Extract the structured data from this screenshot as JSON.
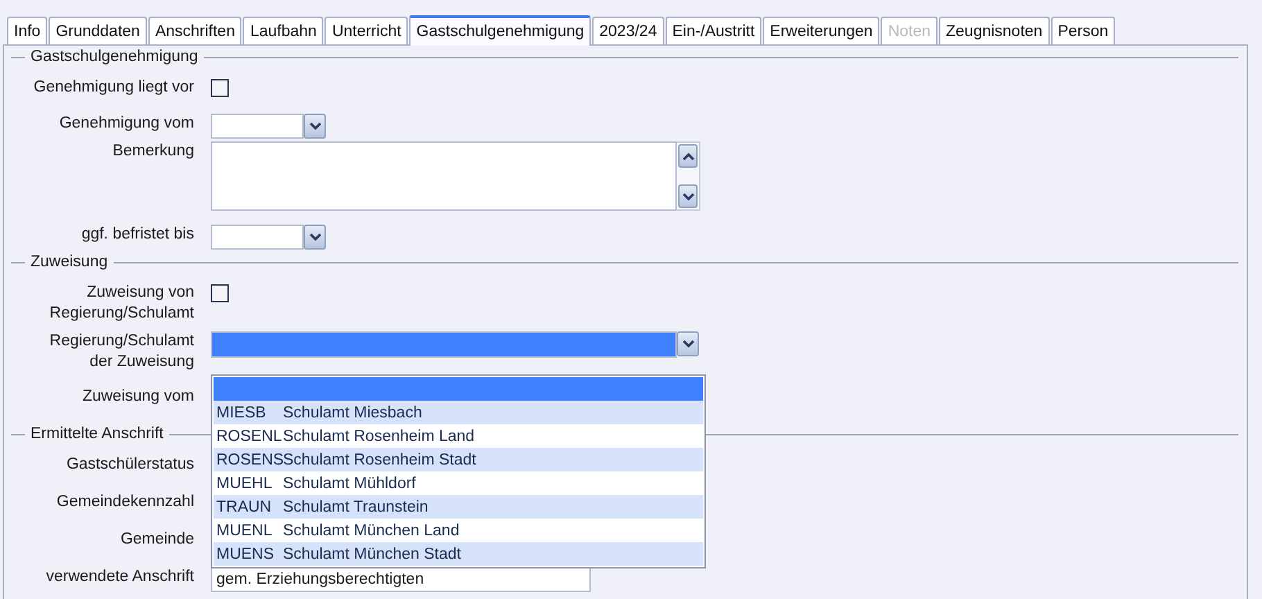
{
  "tabs": [
    {
      "label": "Info",
      "selected": false,
      "disabled": false
    },
    {
      "label": "Grunddaten",
      "selected": false,
      "disabled": false
    },
    {
      "label": "Anschriften",
      "selected": false,
      "disabled": false
    },
    {
      "label": "Laufbahn",
      "selected": false,
      "disabled": false
    },
    {
      "label": "Unterricht",
      "selected": false,
      "disabled": false
    },
    {
      "label": "Gastschulgenehmigung",
      "selected": true,
      "disabled": false
    },
    {
      "label": "2023/24",
      "selected": false,
      "disabled": false
    },
    {
      "label": "Ein-/Austritt",
      "selected": false,
      "disabled": false
    },
    {
      "label": "Erweiterungen",
      "selected": false,
      "disabled": false
    },
    {
      "label": "Noten",
      "selected": false,
      "disabled": true
    },
    {
      "label": "Zeugnisnoten",
      "selected": false,
      "disabled": false
    },
    {
      "label": "Person",
      "selected": false,
      "disabled": false
    }
  ],
  "sections": [
    {
      "title": "Gastschulgenehmigung",
      "rows": [
        {
          "kind": "checkbox",
          "label": "Genehmigung liegt vor",
          "checked": false
        },
        {
          "kind": "date",
          "label": "Genehmigung vom"
        },
        {
          "kind": "memo",
          "label": "Bemerkung"
        },
        {
          "kind": "date",
          "label": "ggf. befristet bis"
        }
      ]
    },
    {
      "title": "Zuweisung",
      "rows": [
        {
          "kind": "checkbox",
          "label": "Zuweisung von\nRegierung/Schulamt",
          "checked": false
        },
        {
          "kind": "combo",
          "label": "Regierung/Schulamt\nder Zuweisung",
          "open": true,
          "options": [
            {
              "code": "MIESB",
              "name": "Schulamt Miesbach",
              "selected": false
            },
            {
              "code": "ROSENL",
              "name": "Schulamt Rosenheim Land",
              "selected": false
            },
            {
              "code": "ROSENS",
              "name": "Schulamt Rosenheim Stadt",
              "selected": false
            },
            {
              "code": "MUEHL",
              "name": "Schulamt Mühldorf",
              "selected": false
            },
            {
              "code": "TRAUN",
              "name": "Schulamt Traunstein",
              "selected": false
            },
            {
              "code": "MUENL",
              "name": "Schulamt München Land",
              "selected": false
            },
            {
              "code": "MUENS",
              "name": "Schulamt München Stadt",
              "selected": false
            }
          ]
        },
        {
          "kind": "covered",
          "label": "Zuweisung vom"
        }
      ]
    },
    {
      "title": "Ermittelte Anschrift",
      "rows": [
        {
          "kind": "covered",
          "label": "Gastschülerstatus"
        },
        {
          "kind": "covered",
          "label": "Gemeindekennzahl"
        },
        {
          "kind": "covered",
          "label": "Gemeinde"
        },
        {
          "kind": "text",
          "label": "verwendete Anschrift",
          "value": "gem. Erziehungsberechtigten"
        }
      ]
    }
  ]
}
